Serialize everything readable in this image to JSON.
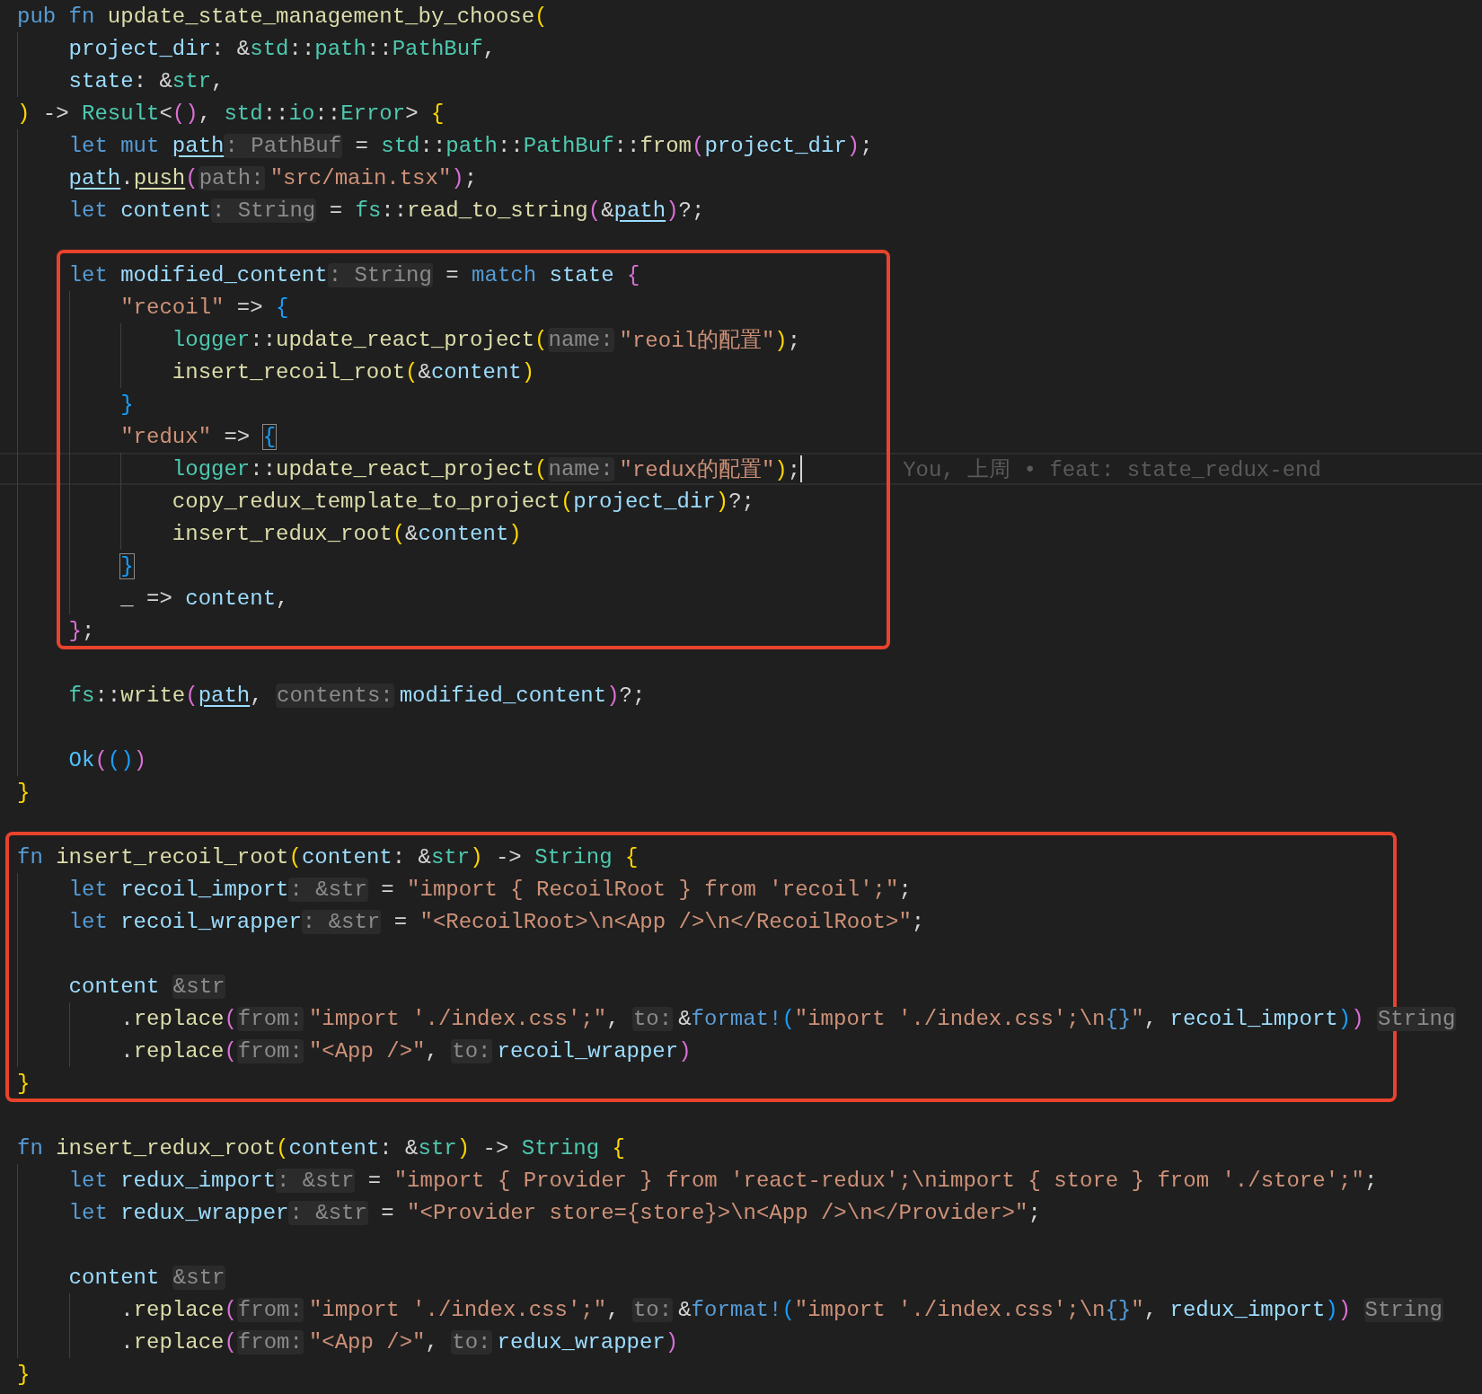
{
  "editor": {
    "lines": [
      {
        "kind": "line",
        "tokens": [
          {
            "kind": "kw",
            "text": "pub "
          },
          {
            "kind": "kw",
            "text": "fn "
          },
          {
            "kind": "fn",
            "text": "update_state_management_by_choose"
          },
          {
            "kind": "b1",
            "text": "("
          }
        ],
        "children": [
          {
            "kind": "line",
            "tokens": [
              {
                "kind": "var",
                "text": "project_dir"
              },
              {
                "kind": "p",
                "text": ": &"
              },
              {
                "kind": "type",
                "text": "std"
              },
              {
                "kind": "p",
                "text": "::"
              },
              {
                "kind": "type",
                "text": "path"
              },
              {
                "kind": "p",
                "text": "::"
              },
              {
                "kind": "type",
                "text": "PathBuf"
              },
              {
                "kind": "p",
                "text": ","
              }
            ]
          },
          {
            "kind": "line",
            "tokens": [
              {
                "kind": "var",
                "text": "state"
              },
              {
                "kind": "p",
                "text": ": &"
              },
              {
                "kind": "type",
                "text": "str"
              },
              {
                "kind": "p",
                "text": ","
              }
            ]
          }
        ]
      },
      {
        "kind": "line",
        "tokens": [
          {
            "kind": "b1",
            "text": ")"
          },
          {
            "kind": "p",
            "text": " -> "
          },
          {
            "kind": "type",
            "text": "Result"
          },
          {
            "kind": "p",
            "text": "<"
          },
          {
            "kind": "b2",
            "text": "()"
          },
          {
            "kind": "p",
            "text": ", "
          },
          {
            "kind": "type",
            "text": "std"
          },
          {
            "kind": "p",
            "text": "::"
          },
          {
            "kind": "type",
            "text": "io"
          },
          {
            "kind": "p",
            "text": "::"
          },
          {
            "kind": "type",
            "text": "Error"
          },
          {
            "kind": "p",
            "text": "> "
          },
          {
            "kind": "b1",
            "text": "{"
          }
        ],
        "children": [
          {
            "kind": "line",
            "tokens": [
              {
                "kind": "kw",
                "text": "let "
              },
              {
                "kind": "kw",
                "text": "mut "
              },
              {
                "kind": "var",
                "text": "path",
                "underline": true
              },
              {
                "kind": "thint",
                "text": ": PathBuf"
              },
              {
                "kind": "p",
                "text": " = "
              },
              {
                "kind": "type",
                "text": "std"
              },
              {
                "kind": "p",
                "text": "::"
              },
              {
                "kind": "type",
                "text": "path"
              },
              {
                "kind": "p",
                "text": "::"
              },
              {
                "kind": "type",
                "text": "PathBuf"
              },
              {
                "kind": "p",
                "text": "::"
              },
              {
                "kind": "fn",
                "text": "from"
              },
              {
                "kind": "b2",
                "text": "("
              },
              {
                "kind": "var",
                "text": "project_dir"
              },
              {
                "kind": "b2",
                "text": ")"
              },
              {
                "kind": "p",
                "text": ";"
              }
            ]
          },
          {
            "kind": "line",
            "tokens": [
              {
                "kind": "var",
                "text": "path",
                "underline": true
              },
              {
                "kind": "p",
                "text": "."
              },
              {
                "kind": "fn",
                "text": "push",
                "underline": true
              },
              {
                "kind": "b2",
                "text": "("
              },
              {
                "kind": "phint",
                "text": "path:"
              },
              {
                "kind": "str",
                "text": "\"src/main.tsx\""
              },
              {
                "kind": "b2",
                "text": ")"
              },
              {
                "kind": "p",
                "text": ";"
              }
            ]
          },
          {
            "kind": "line",
            "tokens": [
              {
                "kind": "kw",
                "text": "let "
              },
              {
                "kind": "var",
                "text": "content"
              },
              {
                "kind": "thint",
                "text": ": String"
              },
              {
                "kind": "p",
                "text": " = "
              },
              {
                "kind": "type",
                "text": "fs"
              },
              {
                "kind": "p",
                "text": "::"
              },
              {
                "kind": "fn",
                "text": "read_to_string"
              },
              {
                "kind": "b2",
                "text": "("
              },
              {
                "kind": "p",
                "text": "&"
              },
              {
                "kind": "var",
                "text": "path",
                "underline": true
              },
              {
                "kind": "b2",
                "text": ")"
              },
              {
                "kind": "p",
                "text": "?;"
              }
            ]
          },
          {
            "kind": "line"
          },
          {
            "kind": "frame",
            "lines": [
              {
                "kind": "line",
                "tokens": [
                  {
                    "kind": "kw",
                    "text": "let "
                  },
                  {
                    "kind": "var",
                    "text": "modified_content"
                  },
                  {
                    "kind": "thint",
                    "text": ": String"
                  },
                  {
                    "kind": "p",
                    "text": " = "
                  },
                  {
                    "kind": "kw",
                    "text": "match "
                  },
                  {
                    "kind": "var",
                    "text": "state "
                  },
                  {
                    "kind": "b2",
                    "text": "{"
                  }
                ],
                "children": [
                  {
                    "kind": "line",
                    "tokens": [
                      {
                        "kind": "str",
                        "text": "\"recoil\""
                      },
                      {
                        "kind": "p",
                        "text": " => "
                      },
                      {
                        "kind": "b3",
                        "text": "{"
                      }
                    ],
                    "children": [
                      {
                        "kind": "line",
                        "tokens": [
                          {
                            "kind": "type",
                            "text": "logger"
                          },
                          {
                            "kind": "p",
                            "text": "::"
                          },
                          {
                            "kind": "fn",
                            "text": "update_react_project"
                          },
                          {
                            "kind": "b1",
                            "text": "("
                          },
                          {
                            "kind": "phint",
                            "text": "name:"
                          },
                          {
                            "kind": "str",
                            "text": "\"reoil的配置\""
                          },
                          {
                            "kind": "b1",
                            "text": ")"
                          },
                          {
                            "kind": "p",
                            "text": ";"
                          }
                        ]
                      },
                      {
                        "kind": "line",
                        "tokens": [
                          {
                            "kind": "fn",
                            "text": "insert_recoil_root"
                          },
                          {
                            "kind": "b1",
                            "text": "("
                          },
                          {
                            "kind": "p",
                            "text": "&"
                          },
                          {
                            "kind": "var",
                            "text": "content"
                          },
                          {
                            "kind": "b1",
                            "text": ")"
                          }
                        ]
                      }
                    ]
                  },
                  {
                    "kind": "line",
                    "tokens": [
                      {
                        "kind": "b3",
                        "text": "}"
                      }
                    ]
                  },
                  {
                    "kind": "line",
                    "tokens": [
                      {
                        "kind": "str",
                        "text": "\"redux\""
                      },
                      {
                        "kind": "p",
                        "text": " => "
                      },
                      {
                        "kind": "b3",
                        "text": "{",
                        "matched": true
                      }
                    ],
                    "children": [
                      {
                        "kind": "line",
                        "cursor": true,
                        "blame": "You, 上周 • feat: state_redux-end",
                        "tokens": [
                          {
                            "kind": "type",
                            "text": "logger"
                          },
                          {
                            "kind": "p",
                            "text": "::"
                          },
                          {
                            "kind": "fn",
                            "text": "update_react_project"
                          },
                          {
                            "kind": "b1",
                            "text": "("
                          },
                          {
                            "kind": "phint",
                            "text": "name:"
                          },
                          {
                            "kind": "str",
                            "text": "\"redux的配置\""
                          },
                          {
                            "kind": "b1",
                            "text": ")"
                          },
                          {
                            "kind": "p",
                            "text": ";"
                          }
                        ]
                      },
                      {
                        "kind": "line",
                        "tokens": [
                          {
                            "kind": "fn",
                            "text": "copy_redux_template_to_project"
                          },
                          {
                            "kind": "b1",
                            "text": "("
                          },
                          {
                            "kind": "var",
                            "text": "project_dir"
                          },
                          {
                            "kind": "b1",
                            "text": ")"
                          },
                          {
                            "kind": "p",
                            "text": "?;"
                          }
                        ]
                      },
                      {
                        "kind": "line",
                        "tokens": [
                          {
                            "kind": "fn",
                            "text": "insert_redux_root"
                          },
                          {
                            "kind": "b1",
                            "text": "("
                          },
                          {
                            "kind": "p",
                            "text": "&"
                          },
                          {
                            "kind": "var",
                            "text": "content"
                          },
                          {
                            "kind": "b1",
                            "text": ")"
                          }
                        ]
                      }
                    ]
                  },
                  {
                    "kind": "line",
                    "tokens": [
                      {
                        "kind": "b3",
                        "text": "}",
                        "matched": true
                      }
                    ]
                  },
                  {
                    "kind": "line",
                    "tokens": [
                      {
                        "kind": "p",
                        "text": "_ => "
                      },
                      {
                        "kind": "var",
                        "text": "content"
                      },
                      {
                        "kind": "p",
                        "text": ","
                      }
                    ]
                  }
                ]
              },
              {
                "kind": "line",
                "tokens": [
                  {
                    "kind": "b2",
                    "text": "}"
                  },
                  {
                    "kind": "p",
                    "text": ";"
                  }
                ]
              }
            ]
          },
          {
            "kind": "line"
          },
          {
            "kind": "line",
            "tokens": [
              {
                "kind": "type",
                "text": "fs"
              },
              {
                "kind": "p",
                "text": "::"
              },
              {
                "kind": "fn",
                "text": "write"
              },
              {
                "kind": "b2",
                "text": "("
              },
              {
                "kind": "var",
                "text": "path",
                "underline": true
              },
              {
                "kind": "p",
                "text": ", "
              },
              {
                "kind": "phint",
                "text": "contents:"
              },
              {
                "kind": "var",
                "text": "modified_content"
              },
              {
                "kind": "b2",
                "text": ")"
              },
              {
                "kind": "p",
                "text": "?;"
              }
            ]
          },
          {
            "kind": "line"
          },
          {
            "kind": "line",
            "tokens": [
              {
                "kind": "enum",
                "text": "Ok"
              },
              {
                "kind": "b2",
                "text": "("
              },
              {
                "kind": "b3",
                "text": "()"
              },
              {
                "kind": "b2",
                "text": ")"
              }
            ]
          }
        ]
      },
      {
        "kind": "line",
        "tokens": [
          {
            "kind": "b1",
            "text": "}"
          }
        ]
      },
      {
        "kind": "line"
      },
      {
        "kind": "frame",
        "lines": [
          {
            "kind": "line",
            "tokens": [
              {
                "kind": "kw",
                "text": "fn "
              },
              {
                "kind": "fn",
                "text": "insert_recoil_root"
              },
              {
                "kind": "b1",
                "text": "("
              },
              {
                "kind": "var",
                "text": "content"
              },
              {
                "kind": "p",
                "text": ": &"
              },
              {
                "kind": "type",
                "text": "str"
              },
              {
                "kind": "b1",
                "text": ")"
              },
              {
                "kind": "p",
                "text": " -> "
              },
              {
                "kind": "type",
                "text": "String "
              },
              {
                "kind": "b1",
                "text": "{"
              }
            ],
            "children": [
              {
                "kind": "line",
                "tokens": [
                  {
                    "kind": "kw",
                    "text": "let "
                  },
                  {
                    "kind": "var",
                    "text": "recoil_import"
                  },
                  {
                    "kind": "thint",
                    "text": ": &str"
                  },
                  {
                    "kind": "p",
                    "text": " = "
                  },
                  {
                    "kind": "str",
                    "text": "\"import { RecoilRoot } from 'recoil';\""
                  },
                  {
                    "kind": "p",
                    "text": ";"
                  }
                ]
              },
              {
                "kind": "line",
                "tokens": [
                  {
                    "kind": "kw",
                    "text": "let "
                  },
                  {
                    "kind": "var",
                    "text": "recoil_wrapper"
                  },
                  {
                    "kind": "thint",
                    "text": ": &str"
                  },
                  {
                    "kind": "p",
                    "text": " = "
                  },
                  {
                    "kind": "str",
                    "text": "\"<RecoilRoot>\\n<App />\\n</RecoilRoot>\""
                  },
                  {
                    "kind": "p",
                    "text": ";"
                  }
                ]
              },
              {
                "kind": "line"
              },
              {
                "kind": "line",
                "tokens": [
                  {
                    "kind": "var",
                    "text": "content "
                  },
                  {
                    "kind": "thint",
                    "text": "&str"
                  }
                ],
                "children": [
                  {
                    "kind": "line",
                    "tokens": [
                      {
                        "kind": "p",
                        "text": "."
                      },
                      {
                        "kind": "fn",
                        "text": "replace"
                      },
                      {
                        "kind": "b2",
                        "text": "("
                      },
                      {
                        "kind": "phint",
                        "text": "from:"
                      },
                      {
                        "kind": "str",
                        "text": "\"import './index.css';\""
                      },
                      {
                        "kind": "p",
                        "text": ", "
                      },
                      {
                        "kind": "phint",
                        "text": "to:"
                      },
                      {
                        "kind": "p",
                        "text": "&"
                      },
                      {
                        "kind": "mac",
                        "text": "format!"
                      },
                      {
                        "kind": "b3",
                        "text": "("
                      },
                      {
                        "kind": "str",
                        "text": "\"import './index.css';\\n"
                      },
                      {
                        "kind": "mac",
                        "text": "{}"
                      },
                      {
                        "kind": "str",
                        "text": "\""
                      },
                      {
                        "kind": "p",
                        "text": ", "
                      },
                      {
                        "kind": "var",
                        "text": "recoil_import"
                      },
                      {
                        "kind": "b3",
                        "text": ")"
                      },
                      {
                        "kind": "b2",
                        "text": ") "
                      },
                      {
                        "kind": "thint",
                        "text": "String"
                      }
                    ]
                  },
                  {
                    "kind": "line",
                    "tokens": [
                      {
                        "kind": "p",
                        "text": "."
                      },
                      {
                        "kind": "fn",
                        "text": "replace"
                      },
                      {
                        "kind": "b2",
                        "text": "("
                      },
                      {
                        "kind": "phint",
                        "text": "from:"
                      },
                      {
                        "kind": "str",
                        "text": "\"<App />\""
                      },
                      {
                        "kind": "p",
                        "text": ", "
                      },
                      {
                        "kind": "phint",
                        "text": "to:"
                      },
                      {
                        "kind": "var",
                        "text": "recoil_wrapper"
                      },
                      {
                        "kind": "b2",
                        "text": ")"
                      }
                    ]
                  }
                ]
              }
            ]
          },
          {
            "kind": "line",
            "tokens": [
              {
                "kind": "b1",
                "text": "}"
              }
            ]
          }
        ]
      },
      {
        "kind": "line"
      },
      {
        "kind": "line",
        "tokens": [
          {
            "kind": "kw",
            "text": "fn "
          },
          {
            "kind": "fn",
            "text": "insert_redux_root"
          },
          {
            "kind": "b1",
            "text": "("
          },
          {
            "kind": "var",
            "text": "content"
          },
          {
            "kind": "p",
            "text": ": &"
          },
          {
            "kind": "type",
            "text": "str"
          },
          {
            "kind": "b1",
            "text": ")"
          },
          {
            "kind": "p",
            "text": " -> "
          },
          {
            "kind": "type",
            "text": "String "
          },
          {
            "kind": "b1",
            "text": "{"
          }
        ],
        "children": [
          {
            "kind": "line",
            "tokens": [
              {
                "kind": "kw",
                "text": "let "
              },
              {
                "kind": "var",
                "text": "redux_import"
              },
              {
                "kind": "thint",
                "text": ": &str"
              },
              {
                "kind": "p",
                "text": " = "
              },
              {
                "kind": "str",
                "text": "\"import { Provider } from 'react-redux';\\nimport { store } from './store';\""
              },
              {
                "kind": "p",
                "text": ";"
              }
            ]
          },
          {
            "kind": "line",
            "tokens": [
              {
                "kind": "kw",
                "text": "let "
              },
              {
                "kind": "var",
                "text": "redux_wrapper"
              },
              {
                "kind": "thint",
                "text": ": &str"
              },
              {
                "kind": "p",
                "text": " = "
              },
              {
                "kind": "str",
                "text": "\"<Provider store={store}>\\n<App />\\n</Provider>\""
              },
              {
                "kind": "p",
                "text": ";"
              }
            ]
          },
          {
            "kind": "line"
          },
          {
            "kind": "line",
            "tokens": [
              {
                "kind": "var",
                "text": "content "
              },
              {
                "kind": "thint",
                "text": "&str"
              }
            ],
            "children": [
              {
                "kind": "line",
                "tokens": [
                  {
                    "kind": "p",
                    "text": "."
                  },
                  {
                    "kind": "fn",
                    "text": "replace"
                  },
                  {
                    "kind": "b2",
                    "text": "("
                  },
                  {
                    "kind": "phint",
                    "text": "from:"
                  },
                  {
                    "kind": "str",
                    "text": "\"import './index.css';\""
                  },
                  {
                    "kind": "p",
                    "text": ", "
                  },
                  {
                    "kind": "phint",
                    "text": "to:"
                  },
                  {
                    "kind": "p",
                    "text": "&"
                  },
                  {
                    "kind": "mac",
                    "text": "format!"
                  },
                  {
                    "kind": "b3",
                    "text": "("
                  },
                  {
                    "kind": "str",
                    "text": "\"import './index.css';\\n"
                  },
                  {
                    "kind": "mac",
                    "text": "{}"
                  },
                  {
                    "kind": "str",
                    "text": "\""
                  },
                  {
                    "kind": "p",
                    "text": ", "
                  },
                  {
                    "kind": "var",
                    "text": "redux_import"
                  },
                  {
                    "kind": "b3",
                    "text": ")"
                  },
                  {
                    "kind": "b2",
                    "text": ") "
                  },
                  {
                    "kind": "thint",
                    "text": "String"
                  }
                ]
              },
              {
                "kind": "line",
                "tokens": [
                  {
                    "kind": "p",
                    "text": "."
                  },
                  {
                    "kind": "fn",
                    "text": "replace"
                  },
                  {
                    "kind": "b2",
                    "text": "("
                  },
                  {
                    "kind": "phint",
                    "text": "from:"
                  },
                  {
                    "kind": "str",
                    "text": "\"<App />\""
                  },
                  {
                    "kind": "p",
                    "text": ", "
                  },
                  {
                    "kind": "phint",
                    "text": "to:"
                  },
                  {
                    "kind": "var",
                    "text": "redux_wrapper"
                  },
                  {
                    "kind": "b2",
                    "text": ")"
                  }
                ]
              }
            ]
          }
        ]
      },
      {
        "kind": "line",
        "tokens": [
          {
            "kind": "b1",
            "text": "}"
          }
        ]
      }
    ]
  }
}
